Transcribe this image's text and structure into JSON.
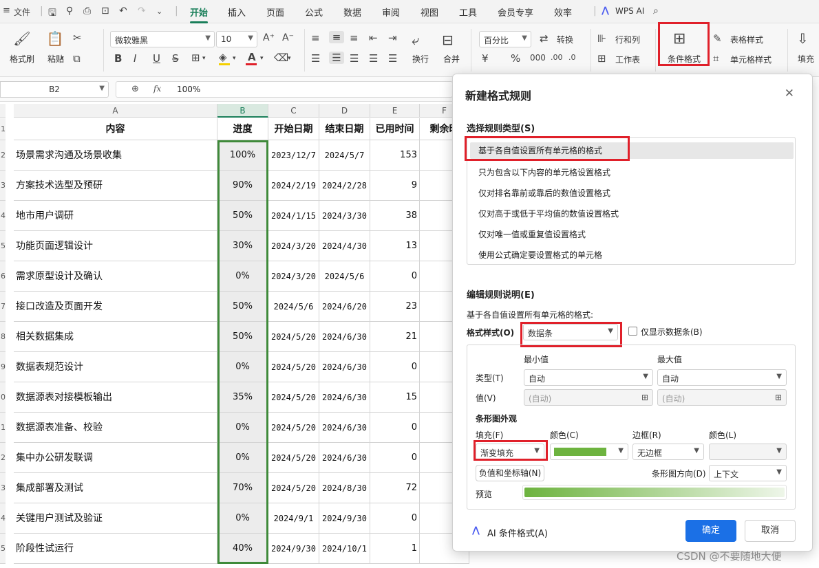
{
  "menubar": {
    "file": "文件",
    "tabs": [
      "开始",
      "插入",
      "页面",
      "公式",
      "数据",
      "审阅",
      "视图",
      "工具",
      "会员专享",
      "效率"
    ],
    "wps_ai": "WPS AI"
  },
  "ribbon": {
    "format_painter": "格式刷",
    "paste": "粘贴",
    "font_name": "微软雅黑",
    "font_size": "10",
    "wrap": "换行",
    "merge": "合并",
    "number_format": "百分比",
    "convert": "转换",
    "row_col": "行和列",
    "worksheet": "工作表",
    "cond_format": "条件格式",
    "table_style": "表格样式",
    "cell_style": "单元格样式",
    "fill": "填充",
    "font_color": "#e0202a",
    "highlight_color": "#f5d000"
  },
  "formula_bar": {
    "cell_ref": "B2",
    "fx": "fx",
    "value": "100%"
  },
  "sheet": {
    "columns": [
      "A",
      "B",
      "C",
      "D",
      "E",
      "F"
    ],
    "row_numbers": [
      "1",
      "2",
      "3",
      "4",
      "5",
      "6",
      "7",
      "8",
      "9",
      "0",
      "1",
      "2",
      "3",
      "4",
      "5"
    ],
    "headers": [
      "内容",
      "进度",
      "开始日期",
      "结束日期",
      "已用时间",
      "剩余时"
    ],
    "rows": [
      {
        "a": "场景需求沟通及场景收集",
        "b": "100%",
        "c": "2023/12/7",
        "d": "2024/5/7",
        "e": "153"
      },
      {
        "a": "方案技术选型及预研",
        "b": "90%",
        "c": "2024/2/19",
        "d": "2024/2/28",
        "e": "9"
      },
      {
        "a": "地市用户调研",
        "b": "50%",
        "c": "2024/1/15",
        "d": "2024/3/30",
        "e": "38"
      },
      {
        "a": "功能页面逻辑设计",
        "b": "30%",
        "c": "2024/3/20",
        "d": "2024/4/30",
        "e": "13"
      },
      {
        "a": "需求原型设计及确认",
        "b": "0%",
        "c": "2024/3/20",
        "d": "2024/5/6",
        "e": "0"
      },
      {
        "a": "接口改造及页面开发",
        "b": "50%",
        "c": "2024/5/6",
        "d": "2024/6/20",
        "e": "23"
      },
      {
        "a": "相关数据集成",
        "b": "50%",
        "c": "2024/5/20",
        "d": "2024/6/30",
        "e": "21"
      },
      {
        "a": "数据表规范设计",
        "b": "0%",
        "c": "2024/5/20",
        "d": "2024/6/30",
        "e": "0"
      },
      {
        "a": "数据源表对接模板输出",
        "b": "35%",
        "c": "2024/5/20",
        "d": "2024/6/30",
        "e": "15"
      },
      {
        "a": "数据源表准备、校验",
        "b": "0%",
        "c": "2024/5/20",
        "d": "2024/6/30",
        "e": "0"
      },
      {
        "a": "集中办公研发联调",
        "b": "0%",
        "c": "2024/5/20",
        "d": "2024/6/30",
        "e": "0"
      },
      {
        "a": "集成部署及测试",
        "b": "70%",
        "c": "2024/5/20",
        "d": "2024/8/30",
        "e": "72"
      },
      {
        "a": "关键用户测试及验证",
        "b": "0%",
        "c": "2024/9/1",
        "d": "2024/9/30",
        "e": "0"
      },
      {
        "a": "阶段性试运行",
        "b": "40%",
        "c": "2024/9/30",
        "d": "2024/10/1",
        "e": "1"
      }
    ]
  },
  "dialog": {
    "title": "新建格式规则",
    "select_rule_type": "选择规则类型(S)",
    "rule_types": [
      "基于各自值设置所有单元格的格式",
      "只为包含以下内容的单元格设置格式",
      "仅对排名靠前或靠后的数值设置格式",
      "仅对高于或低于平均值的数值设置格式",
      "仅对唯一值或重复值设置格式",
      "使用公式确定要设置格式的单元格"
    ],
    "edit_rule": "编辑规则说明(E)",
    "edit_desc": "基于各自值设置所有单元格的格式:",
    "format_style_label": "格式样式(O)",
    "format_style": "数据条",
    "show_bar_only": "仅显示数据条(B)",
    "min_label": "最小值",
    "max_label": "最大值",
    "type_label": "类型(T)",
    "min_type": "自动",
    "max_type": "自动",
    "value_label": "值(V)",
    "min_value": "(自动)",
    "max_value": "(自动)",
    "bar_appearance": "条形图外观",
    "fill_label": "填充(F)",
    "fill": "渐变填充",
    "color_label": "颜色(C)",
    "bar_color": "#6db33f",
    "border_label": "边框(R)",
    "border": "无边框",
    "border_color_label": "颜色(L)",
    "negative_axis": "负值和坐标轴(N)",
    "direction_label": "条形图方向(D)",
    "direction": "上下文",
    "preview_label": "预览",
    "ai_cond": "AI 条件格式(A)",
    "ok": "确定",
    "cancel": "取消"
  },
  "watermark": "CSDN @不要随地大便"
}
